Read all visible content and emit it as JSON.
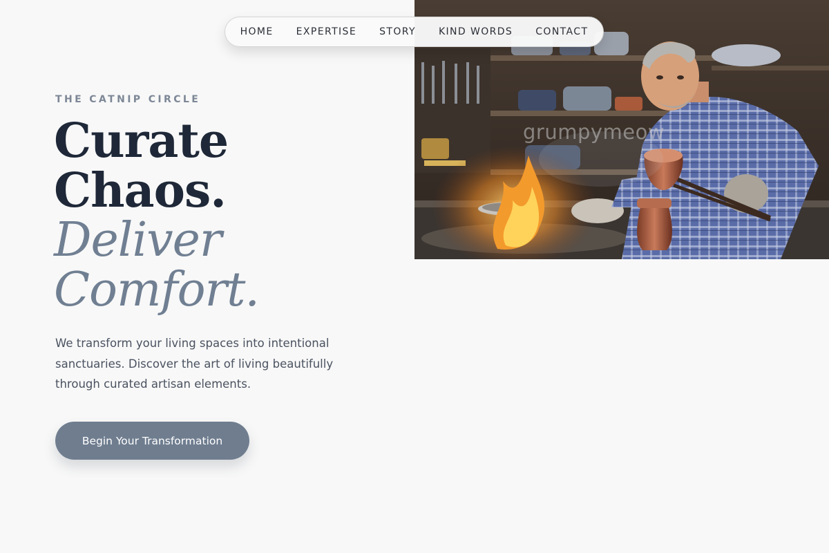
{
  "nav": {
    "items": [
      {
        "label": "HOME"
      },
      {
        "label": "EXPERTISE"
      },
      {
        "label": "STORY"
      },
      {
        "label": "KIND WORDS"
      },
      {
        "label": "CONTACT"
      }
    ]
  },
  "hero": {
    "eyebrow": "THE CATNIP CIRCLE",
    "headline": {
      "line1": "Curate",
      "line2": "Chaos.",
      "line3": "Deliver",
      "line4": "Comfort."
    },
    "description": "We transform your living spaces into intentional sanctuaries. Discover the art of living beautifully through curated artisan elements.",
    "cta_label": "Begin Your Transformation"
  },
  "image": {
    "watermark": "grumpymeow"
  },
  "colors": {
    "background": "#f8f8f8",
    "headline": "#1e2838",
    "accent": "#707f92",
    "cta": "#6f7d8f",
    "eyebrow": "#7d8796"
  }
}
